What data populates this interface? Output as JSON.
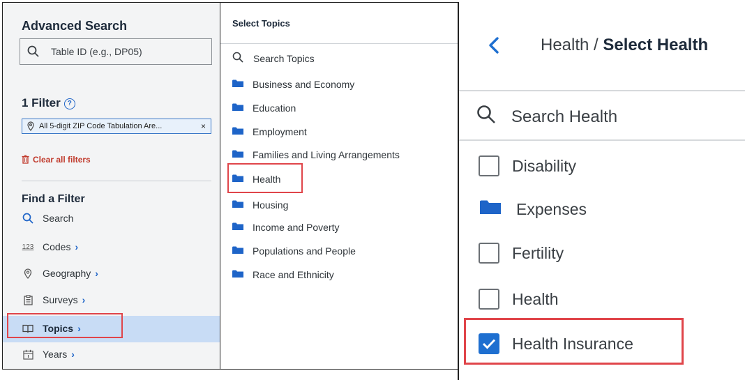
{
  "advanced_search": {
    "title": "Advanced Search",
    "table_id_placeholder": "Table ID (e.g., DP05)",
    "filter_count_label": "1 Filter",
    "help_symbol": "?",
    "active_filter_chip": "All 5-digit ZIP Code Tabulation Are...",
    "chip_remove": "×",
    "clear_all": "Clear all filters",
    "find_filter_title": "Find a Filter",
    "nav_items": [
      {
        "label": "Search",
        "icon": "search-icon"
      },
      {
        "label": "Codes",
        "icon": "codes-123-icon",
        "chevron": "›"
      },
      {
        "label": "Geography",
        "icon": "location-pin-icon",
        "chevron": "›"
      },
      {
        "label": "Surveys",
        "icon": "clipboard-icon",
        "chevron": "›"
      },
      {
        "label": "Topics",
        "icon": "book-icon",
        "chevron": "›",
        "selected": true
      },
      {
        "label": "Years",
        "icon": "calendar-icon",
        "chevron": "›"
      }
    ],
    "codes_icon_text": "123"
  },
  "select_topics": {
    "title": "Select Topics",
    "search_placeholder": "Search Topics",
    "topics": [
      "Business and Economy",
      "Education",
      "Employment",
      "Families and Living Arrangements",
      "Health",
      "Housing",
      "Income and Poverty",
      "Populations and People",
      "Race and Ethnicity"
    ],
    "highlighted_topic": "Health"
  },
  "select_health": {
    "breadcrumb_parent": "Health",
    "breadcrumb_separator": " / ",
    "breadcrumb_current": "Select Health",
    "search_placeholder": "Search Health",
    "items": [
      {
        "label": "Disability",
        "kind": "checkbox",
        "checked": false
      },
      {
        "label": "Expenses",
        "kind": "folder"
      },
      {
        "label": "Fertility",
        "kind": "checkbox",
        "checked": false
      },
      {
        "label": "Health",
        "kind": "checkbox",
        "checked": false
      },
      {
        "label": "Health Insurance",
        "kind": "checkbox",
        "checked": true
      }
    ]
  },
  "colors": {
    "accent_blue": "#1e6fd0",
    "highlight_red": "#e0454a",
    "selected_row": "#c8dcf5",
    "clear_red": "#c0392b"
  }
}
